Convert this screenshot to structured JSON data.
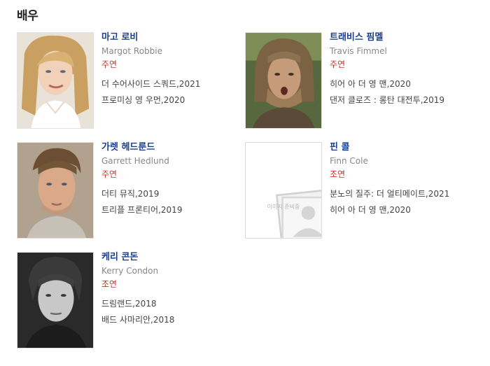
{
  "section": {
    "title": "배우"
  },
  "placeholder_text": "이미지 준비중",
  "actors": [
    {
      "name_ko": "마고 로비",
      "name_en": "Margot Robbie",
      "role": "주연",
      "works": [
        "더 수어사이드 스쿼드,2021",
        "프로미싱 영 우먼,2020"
      ]
    },
    {
      "name_ko": "트래비스 핌멜",
      "name_en": "Travis Fimmel",
      "role": "주연",
      "works": [
        "히어 아 더 영 맨,2020",
        "댄저 클로즈 : 롱탄 대전투,2019"
      ]
    },
    {
      "name_ko": "가렛 헤드룬드",
      "name_en": "Garrett Hedlund",
      "role": "주연",
      "works": [
        "더티 뮤직,2019",
        "트리플 프론티어,2019"
      ]
    },
    {
      "name_ko": "핀 콜",
      "name_en": "Finn Cole",
      "role": "조연",
      "works": [
        "분노의 질주: 더 얼티메이트,2021",
        "히어 아 더 영 맨,2020"
      ]
    },
    {
      "name_ko": "케리 콘돈",
      "name_en": "Kerry Condon",
      "role": "조연",
      "works": [
        "드림랜드,2018",
        "배드 사마리안,2018"
      ]
    }
  ]
}
